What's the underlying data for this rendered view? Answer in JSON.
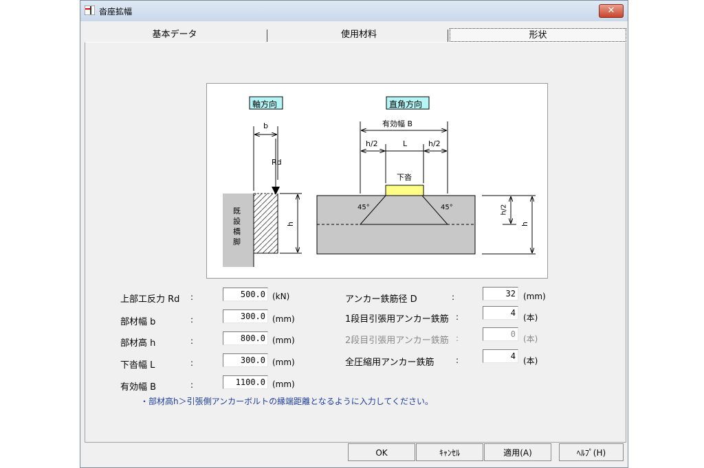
{
  "window": {
    "title": "沓座拡幅",
    "close_glyph": "✕"
  },
  "tabs": [
    {
      "label": "基本データ"
    },
    {
      "label": "使用材料"
    },
    {
      "label": "形状"
    }
  ],
  "diagram": {
    "axial_title": "軸方向",
    "perp_title": "直角方向",
    "dim_b": "b",
    "dim_rd": "Rd",
    "dim_h": "h",
    "pier_text": [
      "既",
      "設",
      "橋",
      "脚"
    ],
    "effective_width": "有効幅  B",
    "dim_half_h": "h/2",
    "dim_l": "L",
    "shoe_label": "下沓",
    "angle": "45°",
    "shoe_color": "#ffff88",
    "concrete_color": "#c8c8c8",
    "title_bg": "#b5f5f5"
  },
  "left_fields": [
    {
      "label": "上部工反力  Rd",
      "colon": ":",
      "value": "500.0",
      "unit": "(kN)"
    },
    {
      "label": "部材幅  b",
      "colon": ":",
      "value": "300.0",
      "unit": "(mm)"
    },
    {
      "label": "部材高  h",
      "colon": ":",
      "value": "800.0",
      "unit": "(mm)"
    },
    {
      "label": "下沓幅  L",
      "colon": ":",
      "value": "300.0",
      "unit": "(mm)"
    },
    {
      "label": "有効幅  B",
      "colon": ":",
      "value": "1100.0",
      "unit": "(mm)"
    }
  ],
  "right_fields": [
    {
      "label": "アンカー鉄筋径  D",
      "colon": ":",
      "value": "32",
      "unit": "(mm)"
    },
    {
      "label": "1段目引張用アンカー鉄筋",
      "colon": ":",
      "value": "4",
      "unit": "(本)"
    },
    {
      "label": "2段目引張用アンカー鉄筋",
      "colon": ":",
      "value": "0",
      "unit": "(本)"
    },
    {
      "label": "全圧縮用アンカー鉄筋",
      "colon": ":",
      "value": "4",
      "unit": "(本)"
    }
  ],
  "note": "・部材高h＞引張側アンカーボルトの縁端距離となるように入力してください。",
  "buttons": {
    "ok": "OK",
    "cancel": "ｷｬﾝｾﾙ",
    "apply": "適用(A)",
    "help": "ﾍﾙﾌﾟ(H)"
  }
}
